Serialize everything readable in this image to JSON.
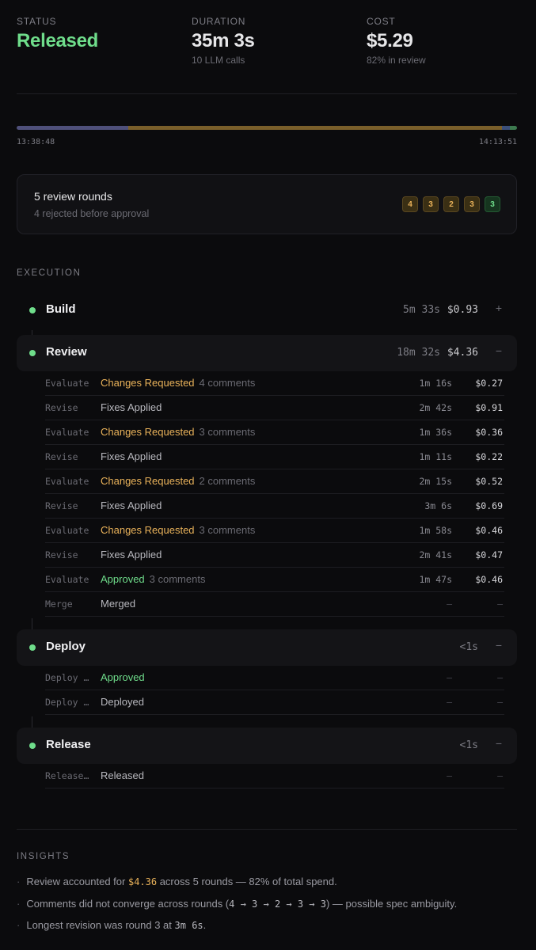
{
  "stats": [
    {
      "label": "STATUS",
      "value": "Released",
      "sub": ""
    },
    {
      "label": "DURATION",
      "value": "35m 3s",
      "sub": "10 LLM calls"
    },
    {
      "label": "COST",
      "value": "$5.29",
      "sub": "82% in review"
    }
  ],
  "timeline": {
    "start": "13:38:48",
    "end": "14:13:51",
    "segments": [
      {
        "share": 0.2235,
        "color": "#4f507a"
      },
      {
        "share": 0.7465,
        "color": "#7a5f2a"
      },
      {
        "share": 0.015,
        "color": "#3b4f7a"
      },
      {
        "share": 0.015,
        "color": "#3d7a4f"
      }
    ]
  },
  "rounds": {
    "title": "5 review rounds",
    "subtitle": "4 rejected before approval",
    "chips": [
      {
        "value": "4",
        "approved": false
      },
      {
        "value": "3",
        "approved": false
      },
      {
        "value": "2",
        "approved": false
      },
      {
        "value": "3",
        "approved": false
      },
      {
        "value": "3",
        "approved": true
      }
    ]
  },
  "execution": {
    "label": "EXECUTION",
    "stages": [
      {
        "name": "Build",
        "duration": "5m 33s",
        "cost": "$0.93",
        "toggle": "+",
        "expanded": false,
        "steps": []
      },
      {
        "name": "Review",
        "duration": "18m 32s",
        "cost": "$4.36",
        "toggle": "−",
        "expanded": true,
        "steps": [
          {
            "kind": "Evaluate",
            "status": "Changes Requested",
            "tone": "warn",
            "comments": "4 comments",
            "duration": "1m 16s",
            "cost": "$0.27"
          },
          {
            "kind": "Revise",
            "status": "Fixes Applied",
            "tone": "",
            "comments": "",
            "duration": "2m 42s",
            "cost": "$0.91"
          },
          {
            "kind": "Evaluate",
            "status": "Changes Requested",
            "tone": "warn",
            "comments": "3 comments",
            "duration": "1m 36s",
            "cost": "$0.36"
          },
          {
            "kind": "Revise",
            "status": "Fixes Applied",
            "tone": "",
            "comments": "",
            "duration": "1m 11s",
            "cost": "$0.22"
          },
          {
            "kind": "Evaluate",
            "status": "Changes Requested",
            "tone": "warn",
            "comments": "2 comments",
            "duration": "2m 15s",
            "cost": "$0.52"
          },
          {
            "kind": "Revise",
            "status": "Fixes Applied",
            "tone": "",
            "comments": "",
            "duration": "3m 6s",
            "cost": "$0.69"
          },
          {
            "kind": "Evaluate",
            "status": "Changes Requested",
            "tone": "warn",
            "comments": "3 comments",
            "duration": "1m 58s",
            "cost": "$0.46"
          },
          {
            "kind": "Revise",
            "status": "Fixes Applied",
            "tone": "",
            "comments": "",
            "duration": "2m 41s",
            "cost": "$0.47"
          },
          {
            "kind": "Evaluate",
            "status": "Approved",
            "tone": "ok",
            "comments": "3 comments",
            "duration": "1m 47s",
            "cost": "$0.46"
          },
          {
            "kind": "Merge",
            "status": "Merged",
            "tone": "",
            "comments": "",
            "duration": "—",
            "cost": "—"
          }
        ]
      },
      {
        "name": "Deploy",
        "duration": "<1s",
        "cost": "",
        "toggle": "−",
        "expanded": true,
        "steps": [
          {
            "kind": "Deploy …",
            "status": "Approved",
            "tone": "ok",
            "comments": "",
            "duration": "—",
            "cost": "—"
          },
          {
            "kind": "Deploy …",
            "status": "Deployed",
            "tone": "",
            "comments": "",
            "duration": "—",
            "cost": "—"
          }
        ]
      },
      {
        "name": "Release",
        "duration": "<1s",
        "cost": "",
        "toggle": "−",
        "expanded": true,
        "steps": [
          {
            "kind": "Release…",
            "status": "Released",
            "tone": "",
            "comments": "",
            "duration": "—",
            "cost": "—"
          }
        ]
      }
    ]
  },
  "insights": {
    "label": "INSIGHTS",
    "items": [
      [
        {
          "t": "Review accounted for "
        },
        {
          "t": "$4.36",
          "code": "amber"
        },
        {
          "t": " across 5 rounds — 82% of total spend."
        }
      ],
      [
        {
          "t": "Comments did not converge across rounds ("
        },
        {
          "t": "4 → 3 → 2 → 3 → 3",
          "code": "plain"
        },
        {
          "t": ") — possible spec ambiguity."
        }
      ],
      [
        {
          "t": "Longest revision was round 3 at "
        },
        {
          "t": "3m 6s",
          "code": "plain"
        },
        {
          "t": "."
        }
      ]
    ]
  }
}
